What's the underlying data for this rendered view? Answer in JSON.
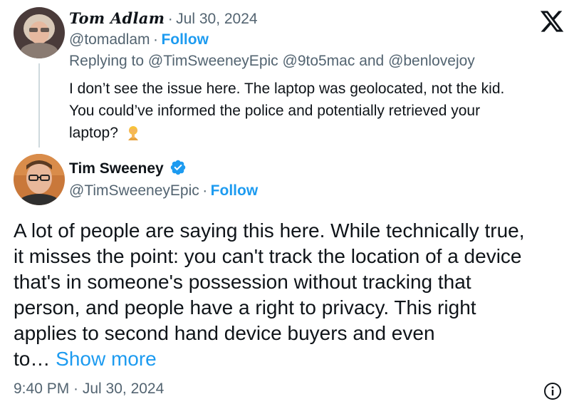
{
  "reply_tweet": {
    "author_name": "Tom Adlam",
    "date": "Jul 30, 2024",
    "handle": "@tomadlam",
    "follow_label": "Follow",
    "replying_to": "Replying to @TimSweeneyEpic @9to5mac and @benlovejoy",
    "body_lines": [
      "I don’t see the issue here. The laptop was geolocated, not the kid.",
      "You could’ve informed the police and potentially retrieved your",
      "laptop?"
    ],
    "emoji": "facepalm-emoji"
  },
  "main_tweet": {
    "author_name": "Tim Sweeney",
    "verified": true,
    "handle": "@TimSweeneyEpic",
    "follow_label": "Follow",
    "body_lines": [
      "A lot of people are saying this here. While technically true,",
      "it misses the point: you can't track the location of a device",
      "that's in someone's possession without tracking that",
      "person, and people have a right to privacy. This right",
      "applies to second hand device buyers and even",
      "to…"
    ],
    "show_more_label": "Show more",
    "timestamp": "9:40 PM · Jul 30, 2024"
  },
  "separators": {
    "dot": "·"
  },
  "icons": {
    "brand": "x-logo-icon",
    "info": "info-icon",
    "verified": "verified-badge-icon"
  },
  "colors": {
    "link": "#1d9bf0",
    "muted": "#536471",
    "text": "#0f1419",
    "verified": "#1d9bf0"
  }
}
